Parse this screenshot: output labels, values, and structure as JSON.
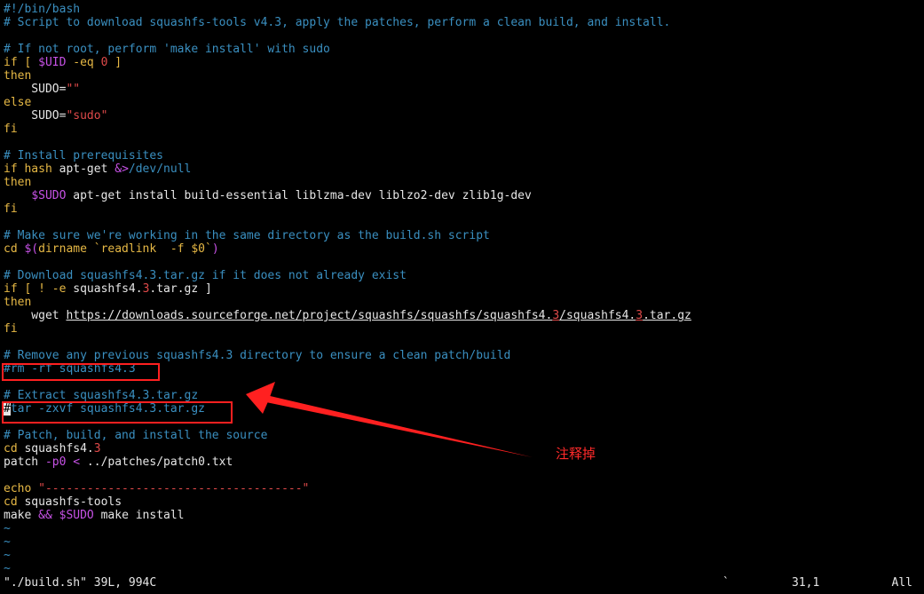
{
  "colors": {
    "background": "#000000",
    "fg": "#e6e6e6",
    "comment": "#3a8fc0",
    "keyword": "#e6b845",
    "variable": "#c752e6",
    "string": "#e04a4a",
    "operator": "#c752e6",
    "annotation": "#ff2020"
  },
  "editor": {
    "lines": [
      [
        {
          "t": "#!/bin/bash",
          "c": "comment"
        }
      ],
      [
        {
          "t": "# Script to download squashfs-tools v4.3, apply the patches, perform a clean build, and install.",
          "c": "comment"
        }
      ],
      [],
      [
        {
          "t": "# If not root, perform 'make install' with sudo",
          "c": "comment"
        }
      ],
      [
        {
          "t": "if",
          "c": "keyword"
        },
        {
          "t": " [ ",
          "c": "keyword"
        },
        {
          "t": "$UID",
          "c": "variable"
        },
        {
          "t": " -eq ",
          "c": "keyword"
        },
        {
          "t": "0",
          "c": "string"
        },
        {
          "t": " ]",
          "c": "keyword"
        }
      ],
      [
        {
          "t": "then",
          "c": "keyword"
        }
      ],
      [
        {
          "t": "    SUDO=",
          "c": "fg"
        },
        {
          "t": "\"\"",
          "c": "string"
        }
      ],
      [
        {
          "t": "else",
          "c": "keyword"
        }
      ],
      [
        {
          "t": "    SUDO=",
          "c": "fg"
        },
        {
          "t": "\"sudo\"",
          "c": "string"
        }
      ],
      [
        {
          "t": "fi",
          "c": "keyword"
        }
      ],
      [],
      [
        {
          "t": "# Install prerequisites",
          "c": "comment"
        }
      ],
      [
        {
          "t": "if",
          "c": "keyword"
        },
        {
          "t": " hash ",
          "c": "keyword"
        },
        {
          "t": "apt-get ",
          "c": "fg"
        },
        {
          "t": "&>",
          "c": "operator"
        },
        {
          "t": "/dev/null",
          "c": "comment"
        }
      ],
      [
        {
          "t": "then",
          "c": "keyword"
        }
      ],
      [
        {
          "t": "    ",
          "c": "fg"
        },
        {
          "t": "$SUDO",
          "c": "variable"
        },
        {
          "t": " apt-get install build-essential liblzma-dev liblzo2-dev zlib1g-dev",
          "c": "fg"
        }
      ],
      [
        {
          "t": "fi",
          "c": "keyword"
        }
      ],
      [],
      [
        {
          "t": "# Make sure we're working in the same directory as the build.sh script",
          "c": "comment"
        }
      ],
      [
        {
          "t": "cd",
          "c": "keyword"
        },
        {
          "t": " ",
          "c": "fg"
        },
        {
          "t": "$(",
          "c": "variable"
        },
        {
          "t": "dirname `readlink  -f $0`",
          "c": "keyword"
        },
        {
          "t": ")",
          "c": "variable"
        }
      ],
      [],
      [
        {
          "t": "# Download squashfs4.3.tar.gz if it does not already exist",
          "c": "comment"
        }
      ],
      [
        {
          "t": "if",
          "c": "keyword"
        },
        {
          "t": " [ ! -e ",
          "c": "keyword"
        },
        {
          "t": "squashfs4.",
          "c": "fg"
        },
        {
          "t": "3",
          "c": "string"
        },
        {
          "t": ".tar.gz ]",
          "c": "fg"
        }
      ],
      [
        {
          "t": "then",
          "c": "keyword"
        }
      ],
      [
        {
          "t": "    wget ",
          "c": "fg"
        },
        {
          "t": "https://downloads.sourceforge.net/project/squashfs/squashfs/squashfs4.",
          "c": "fg",
          "u": true
        },
        {
          "t": "3",
          "c": "string",
          "u": true
        },
        {
          "t": "/squashfs4.",
          "c": "fg",
          "u": true
        },
        {
          "t": "3",
          "c": "string",
          "u": true
        },
        {
          "t": ".tar.gz",
          "c": "fg",
          "u": true
        }
      ],
      [
        {
          "t": "fi",
          "c": "keyword"
        }
      ],
      [],
      [
        {
          "t": "# Remove any previous squashfs4.3 directory to ensure a clean patch/build",
          "c": "comment"
        }
      ],
      [
        {
          "t": "#rm -rf squashfs4.3",
          "c": "comment"
        }
      ],
      [],
      [
        {
          "t": "# Extract squashfs4.3.tar.gz",
          "c": "comment"
        }
      ],
      [
        {
          "t": "#",
          "c": "cursor"
        },
        {
          "t": "tar -zxvf squashfs4.3.tar.gz",
          "c": "comment"
        }
      ],
      [],
      [
        {
          "t": "# Patch, build, and install the source",
          "c": "comment"
        }
      ],
      [
        {
          "t": "cd",
          "c": "keyword"
        },
        {
          "t": " squashfs4.",
          "c": "fg"
        },
        {
          "t": "3",
          "c": "string"
        }
      ],
      [
        {
          "t": "patch ",
          "c": "fg"
        },
        {
          "t": "-p0",
          "c": "variable"
        },
        {
          "t": " ",
          "c": "fg"
        },
        {
          "t": "<",
          "c": "variable"
        },
        {
          "t": " ../patches/patch0.txt",
          "c": "fg"
        }
      ],
      [],
      [
        {
          "t": "echo",
          "c": "keyword"
        },
        {
          "t": " ",
          "c": "fg"
        },
        {
          "t": "\"-------------------------------------\"",
          "c": "string"
        }
      ],
      [
        {
          "t": "cd",
          "c": "keyword"
        },
        {
          "t": " squashfs-tools",
          "c": "fg"
        }
      ],
      [
        {
          "t": "make ",
          "c": "fg"
        },
        {
          "t": "&&",
          "c": "variable"
        },
        {
          "t": " ",
          "c": "fg"
        },
        {
          "t": "$SUDO",
          "c": "variable"
        },
        {
          "t": " make install",
          "c": "fg"
        }
      ],
      [
        {
          "t": "~",
          "c": "comment"
        }
      ],
      [
        {
          "t": "~",
          "c": "comment"
        }
      ],
      [
        {
          "t": "~",
          "c": "comment"
        }
      ],
      [
        {
          "t": "~",
          "c": "comment"
        }
      ]
    ]
  },
  "statusbar": {
    "file_info": "\"./build.sh\" 39L, 994C",
    "pending": "`",
    "position": "31,1",
    "view": "All"
  },
  "annotation": {
    "note": "注释掉"
  }
}
